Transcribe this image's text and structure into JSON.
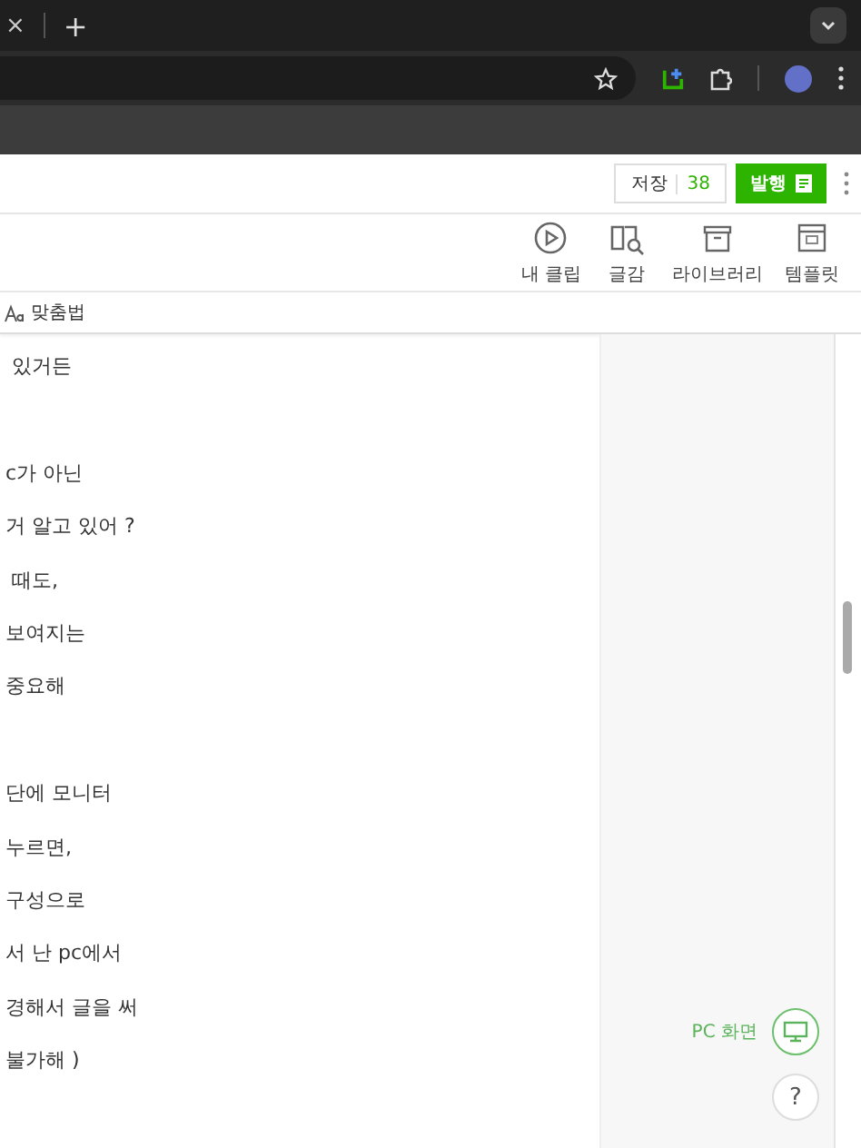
{
  "browser": {
    "new_tab_label": "+",
    "close_tab_label": "×"
  },
  "editor_header": {
    "save": {
      "label": "저장",
      "count": "38"
    },
    "publish": {
      "label": "발행"
    }
  },
  "toolbar": [
    {
      "label": "내 클립",
      "kind": "clip"
    },
    {
      "label": "글감",
      "kind": "book"
    },
    {
      "label": "라이브러리",
      "kind": "box"
    },
    {
      "label": "템플릿",
      "kind": "template"
    }
  ],
  "spellcheck": {
    "label": "맞춤법"
  },
  "paragraphs": [
    {
      "lines": [
        " 있거든"
      ]
    },
    {
      "lines": [
        "c가 아닌",
        "거 알고 있어 ?",
        " 때도,",
        "보여지는",
        "중요해"
      ]
    },
    {
      "lines": [
        "단에 모니터",
        "누르면,",
        "구성으로",
        "서 난 pc에서",
        "경해서 글을 써",
        "불가해 )"
      ]
    }
  ],
  "side": {
    "pc_view_label": "PC 화면",
    "help_label": "?"
  }
}
